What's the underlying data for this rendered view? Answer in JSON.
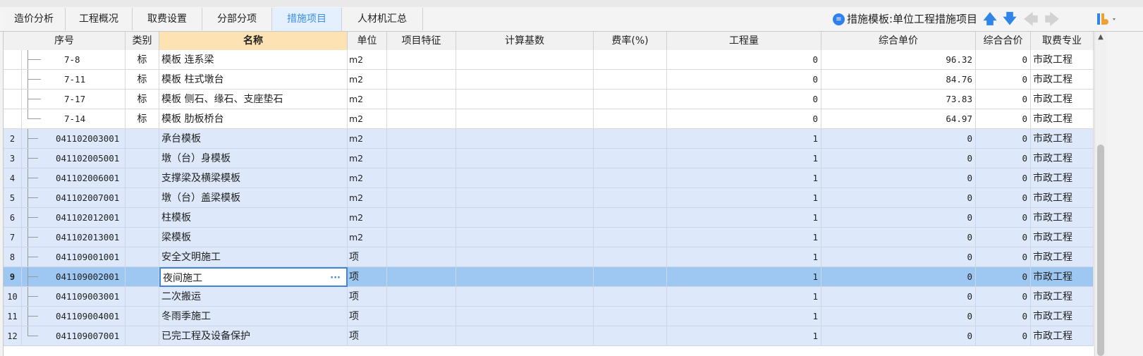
{
  "tabs": [
    {
      "label": "造价分析",
      "active": false
    },
    {
      "label": "工程概况",
      "active": false
    },
    {
      "label": "取费设置",
      "active": false
    },
    {
      "label": "分部分项",
      "active": false
    },
    {
      "label": "措施项目",
      "active": true
    },
    {
      "label": "人材机汇总",
      "active": false
    }
  ],
  "toolbar": {
    "template_label": "措施模板:单位工程措施项目",
    "template_icon": "document-circle-icon",
    "move_up_icon": "arrow-up-icon",
    "move_down_icon": "arrow-down-icon",
    "back_icon": "arrow-left-icon",
    "forward_icon": "arrow-right-icon",
    "settings_icon": "column-settings-icon"
  },
  "colors": {
    "accent": "#2f86e8",
    "row_blue": "#dde9fa",
    "row_selected": "#9ec8f2",
    "header_selected": "#fde3b3"
  },
  "table": {
    "headers": [
      "序号",
      "类别",
      "名称",
      "单位",
      "项目特征",
      "计算基数",
      "费率(%)",
      "工程量",
      "综合单价",
      "综合合价",
      "取费专业"
    ],
    "rows": [
      {
        "idx": "",
        "code": "7-8",
        "type": "标",
        "name": "模板 连系梁",
        "unit": "m2",
        "feature": "",
        "base": "",
        "rate": "",
        "qty": "0",
        "price": "96.32",
        "total": "0",
        "spec": "市政工程"
      },
      {
        "idx": "",
        "code": "7-11",
        "type": "标",
        "name": "模板 柱式墩台",
        "unit": "m2",
        "feature": "",
        "base": "",
        "rate": "",
        "qty": "0",
        "price": "84.76",
        "total": "0",
        "spec": "市政工程"
      },
      {
        "idx": "",
        "code": "7-17",
        "type": "标",
        "name": "模板 侧石、缘石、支座垫石",
        "unit": "m2",
        "feature": "",
        "base": "",
        "rate": "",
        "qty": "0",
        "price": "73.83",
        "total": "0",
        "spec": "市政工程"
      },
      {
        "idx": "",
        "code": "7-14",
        "type": "标",
        "name": "模板 肋板桥台",
        "unit": "m2",
        "feature": "",
        "base": "",
        "rate": "",
        "qty": "0",
        "price": "64.97",
        "total": "0",
        "spec": "市政工程"
      },
      {
        "idx": "2",
        "code": "041102003001",
        "type": "",
        "name": "承台模板",
        "unit": "m2",
        "feature": "",
        "base": "",
        "rate": "",
        "qty": "1",
        "price": "0",
        "total": "0",
        "spec": "市政工程"
      },
      {
        "idx": "3",
        "code": "041102005001",
        "type": "",
        "name": "墩（台）身模板",
        "unit": "m2",
        "feature": "",
        "base": "",
        "rate": "",
        "qty": "1",
        "price": "0",
        "total": "0",
        "spec": "市政工程"
      },
      {
        "idx": "4",
        "code": "041102006001",
        "type": "",
        "name": "支撑梁及横梁模板",
        "unit": "m2",
        "feature": "",
        "base": "",
        "rate": "",
        "qty": "1",
        "price": "0",
        "total": "0",
        "spec": "市政工程"
      },
      {
        "idx": "5",
        "code": "041102007001",
        "type": "",
        "name": "墩（台）盖梁模板",
        "unit": "m2",
        "feature": "",
        "base": "",
        "rate": "",
        "qty": "1",
        "price": "0",
        "total": "0",
        "spec": "市政工程"
      },
      {
        "idx": "6",
        "code": "041102012001",
        "type": "",
        "name": "柱模板",
        "unit": "m2",
        "feature": "",
        "base": "",
        "rate": "",
        "qty": "1",
        "price": "0",
        "total": "0",
        "spec": "市政工程"
      },
      {
        "idx": "7",
        "code": "041102013001",
        "type": "",
        "name": "梁模板",
        "unit": "m2",
        "feature": "",
        "base": "",
        "rate": "",
        "qty": "1",
        "price": "0",
        "total": "0",
        "spec": "市政工程"
      },
      {
        "idx": "8",
        "code": "041109001001",
        "type": "",
        "name": "安全文明施工",
        "unit": "项",
        "feature": "",
        "base": "",
        "rate": "",
        "qty": "1",
        "price": "0",
        "total": "0",
        "spec": "市政工程"
      },
      {
        "idx": "9",
        "code": "041109002001",
        "type": "",
        "name": "夜间施工",
        "unit": "项",
        "feature": "",
        "base": "",
        "rate": "",
        "qty": "1",
        "price": "0",
        "total": "0",
        "spec": "市政工程"
      },
      {
        "idx": "10",
        "code": "041109003001",
        "type": "",
        "name": "二次搬运",
        "unit": "项",
        "feature": "",
        "base": "",
        "rate": "",
        "qty": "1",
        "price": "0",
        "total": "0",
        "spec": "市政工程"
      },
      {
        "idx": "11",
        "code": "041109004001",
        "type": "",
        "name": "冬雨季施工",
        "unit": "项",
        "feature": "",
        "base": "",
        "rate": "",
        "qty": "1",
        "price": "0",
        "total": "0",
        "spec": "市政工程"
      },
      {
        "idx": "12",
        "code": "041109007001",
        "type": "",
        "name": "已完工程及设备保护",
        "unit": "项",
        "feature": "",
        "base": "",
        "rate": "",
        "qty": "1",
        "price": "0",
        "total": "0",
        "spec": "市政工程"
      }
    ],
    "selected_row": "9",
    "name_edit_button": "···"
  }
}
